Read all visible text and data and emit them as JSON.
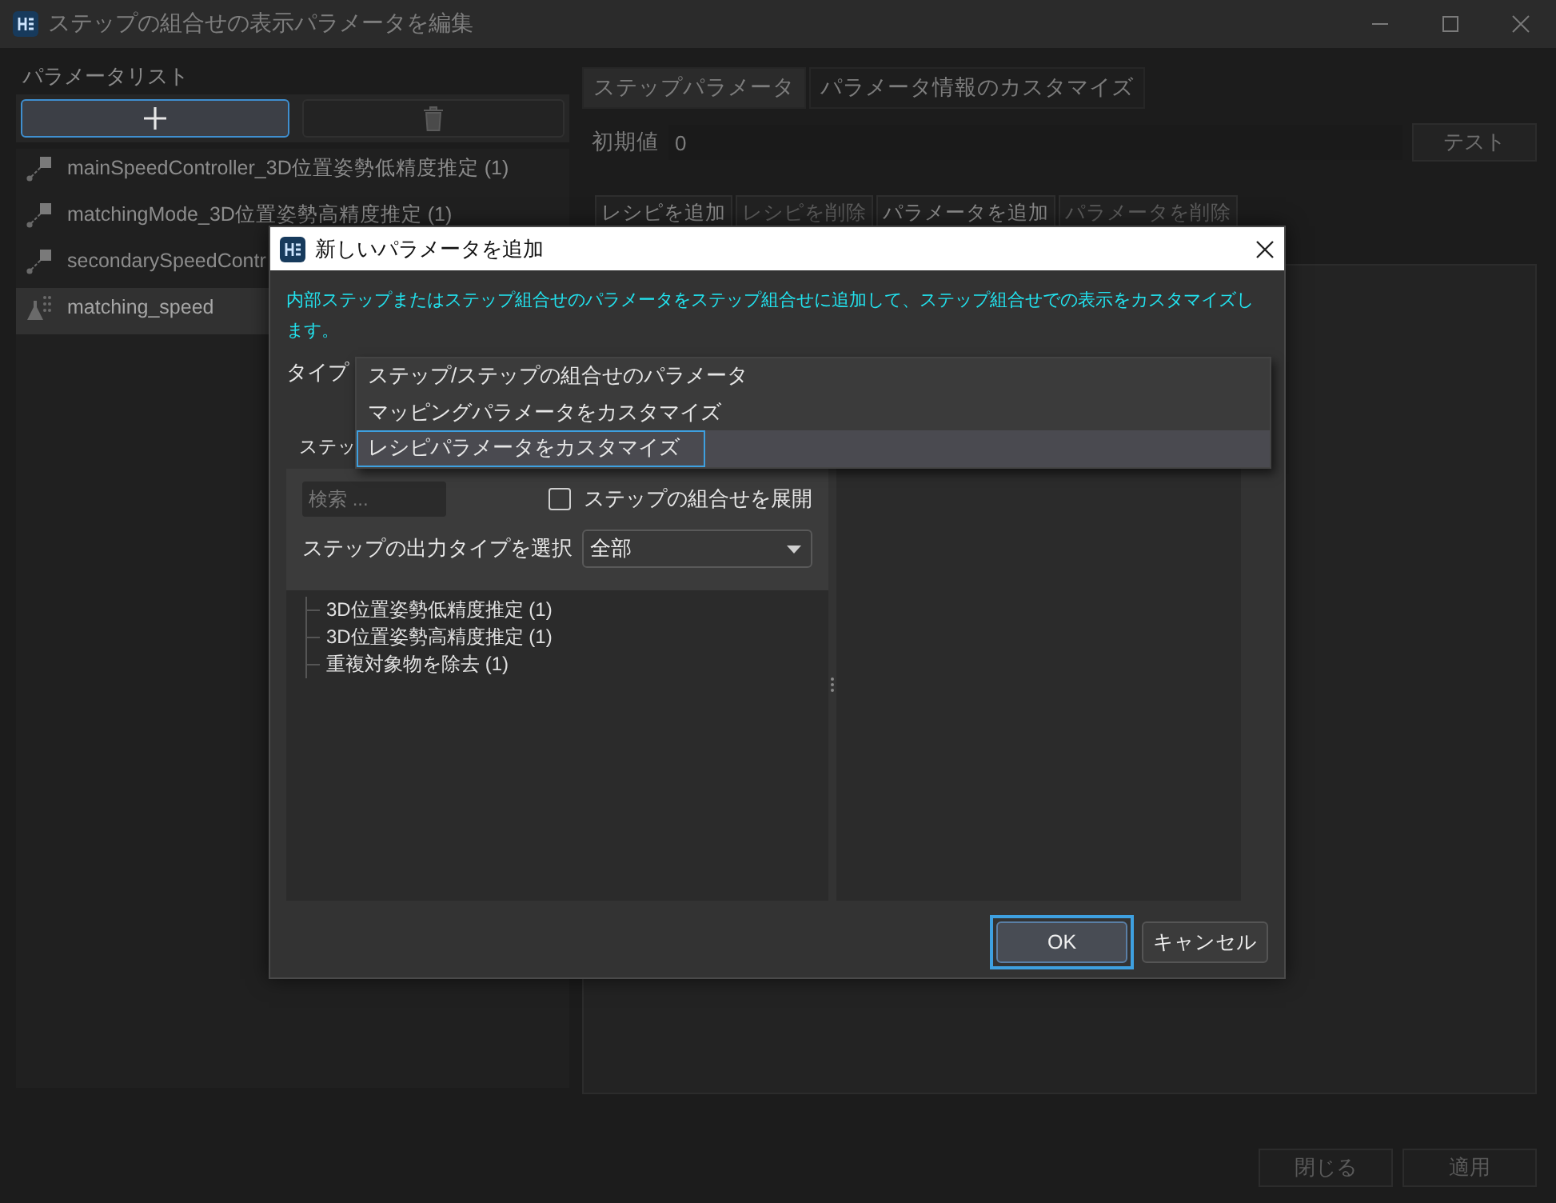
{
  "window": {
    "title": "ステップの組合せの表示パラメータを編集"
  },
  "sidebar": {
    "heading": "パラメータリスト",
    "add_button": {
      "focused": true
    },
    "delete_button": {
      "focused": false
    },
    "items": [
      {
        "kind": "step",
        "label": "mainSpeedController_3D位置姿勢低精度推定 (1)",
        "selected": false
      },
      {
        "kind": "step",
        "label": "matchingMode_3D位置姿勢高精度推定 (1)",
        "selected": false
      },
      {
        "kind": "step",
        "label": "secondarySpeedContr",
        "selected": false
      },
      {
        "kind": "recipe",
        "label": "matching_speed",
        "selected": true
      }
    ]
  },
  "tabs": [
    {
      "label": "ステップパラメータ",
      "selected": true
    },
    {
      "label": "パラメータ情報のカスタマイズ",
      "selected": false
    }
  ],
  "initial_value": {
    "label": "初期値",
    "value": "0"
  },
  "test_button": "テスト",
  "recipe_buttons": [
    {
      "label": "レシピを追加",
      "disabled": false
    },
    {
      "label": "レシピを削除",
      "disabled": true
    },
    {
      "label": "パラメータを追加",
      "disabled": false
    },
    {
      "label": "パラメータを削除",
      "disabled": true
    }
  ],
  "footer_buttons": [
    "閉じる",
    "適用"
  ],
  "dialog": {
    "title": "新しいパラメータを追加",
    "description": "内部ステップまたはステップ組合せのパラメータをステップ組合せに追加して、ステップ組合せでの表示をカスタマイズします。",
    "type_label": "タイプ",
    "type_options": [
      {
        "label": "ステップ/ステップの組合せのパラメータ",
        "selected": false
      },
      {
        "label": "マッピングパラメータをカスタマイズ",
        "selected": false
      },
      {
        "label": "レシピパラメータをカスタマイズ",
        "selected": true
      }
    ],
    "step_label": "ステッ",
    "search": {
      "placeholder": "検索 ..."
    },
    "expand_checkbox": {
      "label": "ステップの組合せを展開",
      "checked": false
    },
    "output_type": {
      "label": "ステップの出力タイプを選択",
      "value": "全部"
    },
    "steps": [
      {
        "label": "3D位置姿勢低精度推定 (1)"
      },
      {
        "label": "3D位置姿勢高精度推定 (1)"
      },
      {
        "label": "重複対象物を除去 (1)"
      }
    ],
    "ok_button": {
      "label": "OK",
      "focused": true
    },
    "cancel_button": {
      "label": "キャンセル",
      "focused": false
    }
  }
}
